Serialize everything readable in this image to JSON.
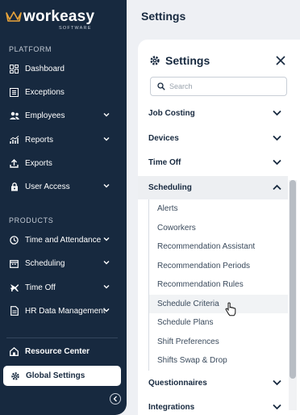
{
  "brand": {
    "name": "workeasy",
    "sub": "SOFTWARE"
  },
  "sidebar": {
    "platform_label": "PLATFORM",
    "platform_items": [
      {
        "label": "Dashboard",
        "icon": "dashboard-icon"
      },
      {
        "label": "Exceptions",
        "icon": "list-icon"
      },
      {
        "label": "Employees",
        "icon": "people-icon",
        "has_chevron": true
      },
      {
        "label": "Reports",
        "icon": "chart-icon",
        "has_chevron": true
      },
      {
        "label": "Exports",
        "icon": "upload-icon"
      },
      {
        "label": "User Access",
        "icon": "lock-icon",
        "has_chevron": true
      }
    ],
    "products_label": "PRODUCTS",
    "product_items": [
      {
        "label": "Time and Attendance",
        "icon": "clock-icon",
        "has_chevron": true
      },
      {
        "label": "Scheduling",
        "icon": "calendar-icon",
        "has_chevron": true
      },
      {
        "label": "Time Off",
        "icon": "plane-icon",
        "has_chevron": true
      },
      {
        "label": "HR Data Management",
        "icon": "document-icon",
        "has_chevron": true
      }
    ],
    "resource_center": "Resource Center",
    "global_settings": "Global Settings"
  },
  "page_title": "Settings",
  "panel": {
    "title": "Settings",
    "search_placeholder": "Search",
    "groups_before": [
      "Job Costing",
      "Devices",
      "Time Off"
    ],
    "open_group": "Scheduling",
    "open_group_items": [
      "Alerts",
      "Coworkers",
      "Recommendation Assistant",
      "Recommendation Periods",
      "Recommendation Rules",
      "Schedule Criteria",
      "Schedule Plans",
      "Shift Preferences",
      "Shifts Swap & Drop"
    ],
    "hovered_item": "Schedule Criteria",
    "groups_after": [
      "Questionnaires",
      "Integrations"
    ]
  },
  "colors": {
    "sidebar_bg": "#17293f",
    "accent_gold": "#e8a33a",
    "panel_bg": "#ffffff"
  }
}
